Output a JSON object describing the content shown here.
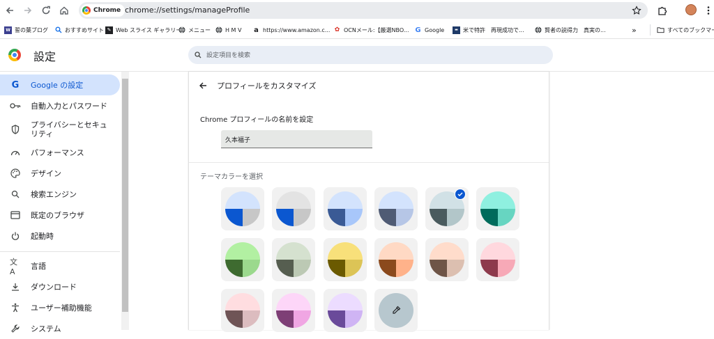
{
  "browser": {
    "site_chip": "Chrome",
    "url": "chrome://settings/manageProfile"
  },
  "bookmarks": [
    {
      "label": "誓の葉ブログ",
      "icon": "blog-icon"
    },
    {
      "label": "おすすめサイト",
      "icon": "search-icon"
    },
    {
      "label": "Web スライス ギャラリー",
      "icon": "web-slice-icon"
    },
    {
      "label": "メニュー",
      "icon": "globe-icon"
    },
    {
      "label": "H M V",
      "icon": "globe-icon"
    },
    {
      "label": "https://www.amazon.c...",
      "icon": "amazon-icon"
    },
    {
      "label": "OCNメール:【厳選NBO...",
      "icon": "ocn-icon"
    },
    {
      "label": "Google",
      "icon": "google-icon"
    },
    {
      "label": "米で特許　再現成功で...",
      "icon": "news-icon"
    },
    {
      "label": "賢者の説得力　真実の...",
      "icon": "globe-icon"
    },
    {
      "label": "すべてのブックマーク",
      "icon": "folder-icon"
    }
  ],
  "header": {
    "title": "設定",
    "search_placeholder": "設定項目を検索"
  },
  "sidebar": {
    "items": [
      {
        "label": "Google の設定",
        "icon": "google-g-icon",
        "active": true
      },
      {
        "label": "自動入力とパスワード",
        "icon": "key-icon"
      },
      {
        "label": "プライバシーとセキュリティ",
        "icon": "shield-icon"
      },
      {
        "label": "パフォーマンス",
        "icon": "speedometer-icon"
      },
      {
        "label": "デザイン",
        "icon": "palette-icon"
      },
      {
        "label": "検索エンジン",
        "icon": "search-icon"
      },
      {
        "label": "既定のブラウザ",
        "icon": "browser-window-icon"
      },
      {
        "label": "起動時",
        "icon": "power-icon"
      },
      {
        "label": "言語",
        "icon": "translate-icon"
      },
      {
        "label": "ダウンロード",
        "icon": "download-icon"
      },
      {
        "label": "ユーザー補助機能",
        "icon": "accessibility-icon"
      },
      {
        "label": "システム",
        "icon": "wrench-icon"
      }
    ]
  },
  "card": {
    "title": "プロフィールをカスタマイズ",
    "name_label": "Chrome プロフィールの名前を設定",
    "name_value": "久本福子",
    "theme_label": "テーマカラーを選択"
  },
  "themes": [
    {
      "top": "#d3e3fd",
      "bl": "#0b57d0",
      "br": "#c7c7c7",
      "selected": false
    },
    {
      "top": "#e3e3e3",
      "bl": "#0b57d0",
      "br": "#c7c7c7",
      "selected": false
    },
    {
      "top": "#d3e3fd",
      "bl": "#3a5a95",
      "br": "#a8c7fa",
      "selected": false
    },
    {
      "top": "#d3e3fd",
      "bl": "#4f5b74",
      "br": "#b6c6e6",
      "selected": false
    },
    {
      "top": "#d1e1e6",
      "bl": "#4a5b5e",
      "br": "#b2c6c9",
      "selected": true
    },
    {
      "top": "#8ff0e0",
      "bl": "#006b5b",
      "br": "#67d5c1",
      "selected": false
    },
    {
      "top": "#b2f0a2",
      "bl": "#3e6b30",
      "br": "#9bd98d",
      "selected": false
    },
    {
      "top": "#d5e1cf",
      "bl": "#565e50",
      "br": "#bcc9b4",
      "selected": false
    },
    {
      "top": "#f8e07a",
      "bl": "#6b5a00",
      "br": "#dcc456",
      "selected": false
    },
    {
      "top": "#ffd9c4",
      "bl": "#8b4a1d",
      "br": "#ffb28a",
      "selected": false
    },
    {
      "top": "#ffdccb",
      "bl": "#6e5547",
      "br": "#dcbfb0",
      "selected": false
    },
    {
      "top": "#ffd8de",
      "bl": "#8d3a4c",
      "br": "#f7a9b7",
      "selected": false
    },
    {
      "top": "#ffdde0",
      "bl": "#6f5456",
      "br": "#dcbcbf",
      "selected": false
    },
    {
      "top": "#fdd6f8",
      "bl": "#7e3f76",
      "br": "#f0a6e3",
      "selected": false
    },
    {
      "top": "#ecdcff",
      "bl": "#6a4a9a",
      "br": "#cfb4f4",
      "selected": false
    }
  ]
}
